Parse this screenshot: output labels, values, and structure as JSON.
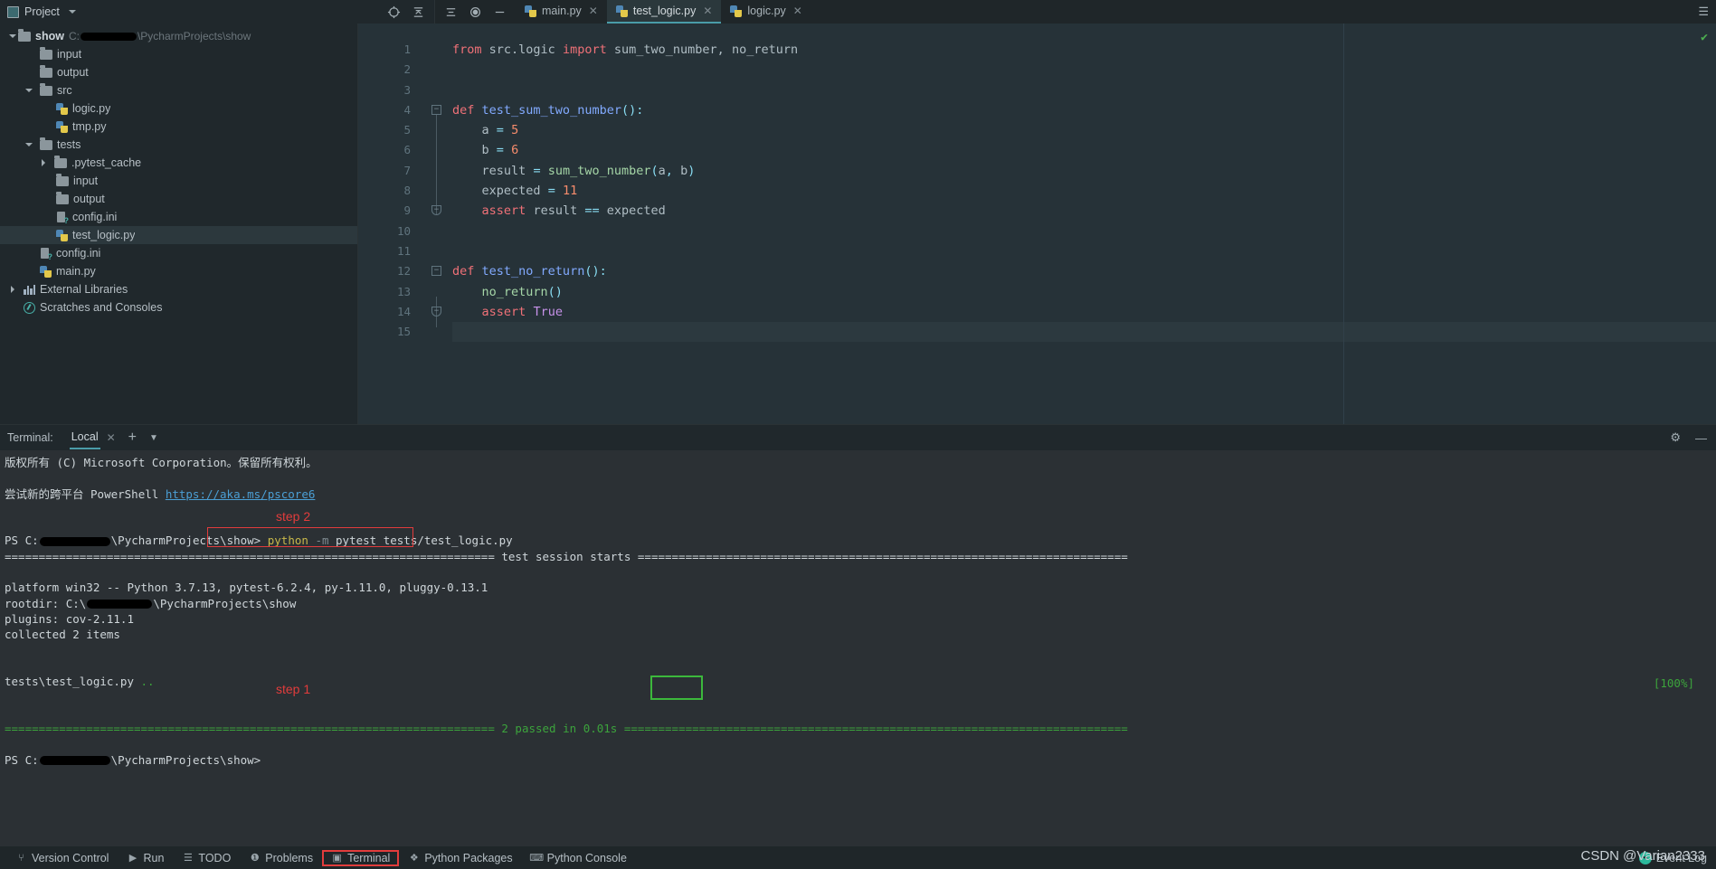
{
  "window": {
    "project_label": "Project",
    "tool_icons": [
      "locate-icon",
      "collapse-all-icon",
      "expand-icon",
      "settings-icon",
      "minimize-icon"
    ]
  },
  "sidebar": {
    "items": [
      {
        "label": "show",
        "path_suffix": "\\PycharmProjects\\show",
        "type": "folder",
        "depth": 0,
        "arrow": "down",
        "bold": true,
        "redacted": true
      },
      {
        "label": "input",
        "type": "folder",
        "depth": 1,
        "arrow": ""
      },
      {
        "label": "output",
        "type": "folder",
        "depth": 1,
        "arrow": ""
      },
      {
        "label": "src",
        "type": "folder",
        "depth": 1,
        "arrow": "down"
      },
      {
        "label": "logic.py",
        "type": "python",
        "depth": 2,
        "arrow": ""
      },
      {
        "label": "tmp.py",
        "type": "python",
        "depth": 2,
        "arrow": ""
      },
      {
        "label": "tests",
        "type": "folder",
        "depth": 1,
        "arrow": "down"
      },
      {
        "label": ".pytest_cache",
        "type": "folder",
        "depth": 2,
        "arrow": "right"
      },
      {
        "label": "input",
        "type": "folder",
        "depth": 2,
        "arrow": ""
      },
      {
        "label": "output",
        "type": "folder",
        "depth": 2,
        "arrow": ""
      },
      {
        "label": "config.ini",
        "type": "ini",
        "depth": 2,
        "arrow": ""
      },
      {
        "label": "test_logic.py",
        "type": "python",
        "depth": 2,
        "arrow": "",
        "selected": true
      },
      {
        "label": "config.ini",
        "type": "ini",
        "depth": 1,
        "arrow": ""
      },
      {
        "label": "main.py",
        "type": "python",
        "depth": 1,
        "arrow": ""
      },
      {
        "label": "External Libraries",
        "type": "library",
        "depth": 0,
        "arrow": "right"
      },
      {
        "label": "Scratches and Consoles",
        "type": "scratch",
        "depth": 0,
        "arrow": ""
      }
    ]
  },
  "editor": {
    "tabs": [
      {
        "label": "main.py",
        "icon": "python-file-icon",
        "active": false
      },
      {
        "label": "test_logic.py",
        "icon": "python-file-icon",
        "active": true
      },
      {
        "label": "logic.py",
        "icon": "python-file-icon",
        "active": false
      }
    ],
    "line_numbers": [
      "1",
      "2",
      "3",
      "4",
      "5",
      "6",
      "7",
      "8",
      "9",
      "10",
      "11",
      "12",
      "13",
      "14",
      "15"
    ],
    "code": [
      "from src.logic import sum_two_number, no_return",
      "",
      "",
      "def test_sum_two_number():",
      "    a = 5",
      "    b = 6",
      "    result = sum_two_number(a, b)",
      "    expected = 11",
      "    assert result == expected",
      "",
      "",
      "def test_no_return():",
      "    no_return()",
      "    assert True",
      ""
    ],
    "run_marker_lines": [
      4,
      12
    ],
    "current_line": 15,
    "inspection_status": "ok-check"
  },
  "terminal": {
    "title": "Terminal:",
    "tab": "Local",
    "add_label": "+",
    "settings_icon": "gear-icon",
    "minimize_icon": "minimize-icon",
    "lines": [
      "版权所有 (C) Microsoft Corporation。保留所有权利。",
      "",
      "尝试新的跨平台 PowerShell https://aka.ms/pscore6",
      "",
      "PS C:\\...\\PycharmProjects\\show> python -m pytest tests/test_logic.py",
      "============================= test session starts =============================",
      "platform win32 -- Python 3.7.13, pytest-6.2.4, py-1.11.0, pluggy-0.13.1",
      "rootdir: C:\\...\\PycharmProjects\\show",
      "plugins: cov-2.11.1",
      "collected 2 items",
      "",
      "tests\\test_logic.py ..                                                  [100%]",
      "",
      "============================== 2 passed in 0.01s ==============================",
      "PS C:\\...\\PycharmProjects\\show>"
    ],
    "powershell_url": "https://aka.ms/pscore6",
    "prompt_prefix": "PS C:",
    "prompt_suffix": "\\PycharmProjects\\show>",
    "command": "python -m pytest tests/test_logic.py",
    "command_exe": "python",
    "command_flag": "-m",
    "command_args": "pytest tests/test_logic.py",
    "session_start_line": "test session starts",
    "platform_line": "platform win32 -- Python 3.7.13, pytest-6.2.4, py-1.11.0, pluggy-0.13.1",
    "rootdir_prefix": "rootdir: C:\\",
    "rootdir_suffix": "\\PycharmProjects\\show",
    "plugins_line": "plugins: cov-2.11.1",
    "collected_line": "collected 2 items",
    "result_file": "tests\\test_logic.py",
    "result_dots": "..",
    "percent": "[100%]",
    "summary_passed": "2 passed",
    "summary_time": "in 0.01s",
    "annotations": [
      {
        "label": "step 2",
        "color": "#e23c3c"
      },
      {
        "label": "step 1",
        "color": "#e23c3c"
      }
    ],
    "highlight_colors": {
      "red": "#e23c3c",
      "green": "#3cb83c"
    }
  },
  "statusbar": {
    "items": [
      {
        "label": "Version Control",
        "icon": "branch-icon",
        "highlighted": false
      },
      {
        "label": "Run",
        "icon": "play-icon",
        "highlighted": false
      },
      {
        "label": "TODO",
        "icon": "list-icon",
        "highlighted": false
      },
      {
        "label": "Problems",
        "icon": "warning-icon",
        "highlighted": false
      },
      {
        "label": "Terminal",
        "icon": "terminal-icon",
        "highlighted": true
      },
      {
        "label": "Python Packages",
        "icon": "packages-icon",
        "highlighted": false
      },
      {
        "label": "Python Console",
        "icon": "console-icon",
        "highlighted": false
      }
    ],
    "event_log": "Event Log",
    "watermark": "CSDN @Varian2333"
  }
}
